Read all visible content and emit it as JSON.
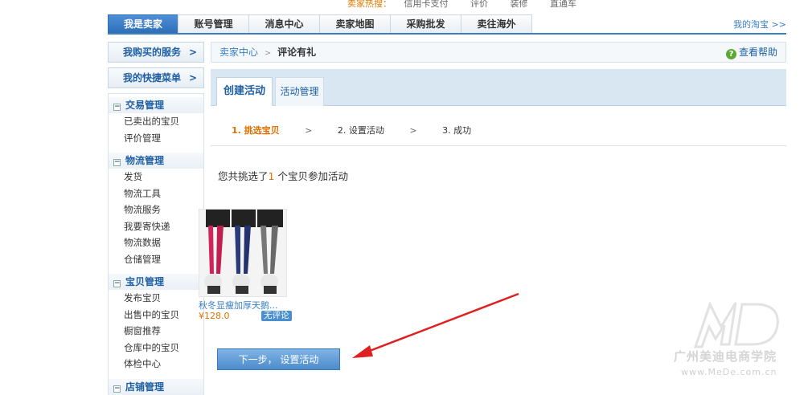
{
  "hot": {
    "label": "卖家热搜：",
    "links": [
      "信用卡支付",
      "评价",
      "装修",
      "直通车"
    ]
  },
  "topnav": {
    "tabs": [
      "我是卖家",
      "账号管理",
      "消息中心",
      "卖家地图",
      "采购批发",
      "卖往海外"
    ],
    "active_index": 0,
    "my_taobao": "我的淘宝 >>"
  },
  "sidebar": {
    "service_btn": "我购买的服务",
    "shortcut_btn": "我的快捷菜单",
    "arrow": ">",
    "groups": [
      {
        "title": "交易管理",
        "items": [
          "已卖出的宝贝",
          "评价管理"
        ]
      },
      {
        "title": "物流管理",
        "items": [
          "发货",
          "物流工具",
          "物流服务",
          "我要寄快递",
          "物流数据",
          "仓储管理"
        ]
      },
      {
        "title": "宝贝管理",
        "items": [
          "发布宝贝",
          "出售中的宝贝",
          "橱窗推荐",
          "仓库中的宝贝",
          "体检中心"
        ]
      },
      {
        "title": "店铺管理",
        "items": []
      }
    ]
  },
  "breadcrumb": {
    "parent": "卖家中心",
    "sep": ">",
    "current": "评论有礼",
    "help": "查看帮助",
    "help_icon": "?"
  },
  "tabs": {
    "create": "创建活动",
    "manage": "活动管理"
  },
  "steps": {
    "s1": "1. 挑选宝贝",
    "s2": "2. 设置活动",
    "s3": "3. 成功",
    "gt": ">"
  },
  "summary": {
    "prefix": "您共挑选了",
    "count": "1",
    "suffix": " 个宝贝参加活动"
  },
  "product": {
    "name": "秋冬显瘦加厚天鹅...",
    "price": "¥128.0",
    "badge": "无评论"
  },
  "next_button": "下一步， 设置活动",
  "watermark": {
    "name": "广州美迪电商学院",
    "url": "www.MeDe.com.cn"
  },
  "colors": {
    "accent": "#3a7fc4",
    "orange": "#e07000",
    "arrow": "#e02020"
  }
}
